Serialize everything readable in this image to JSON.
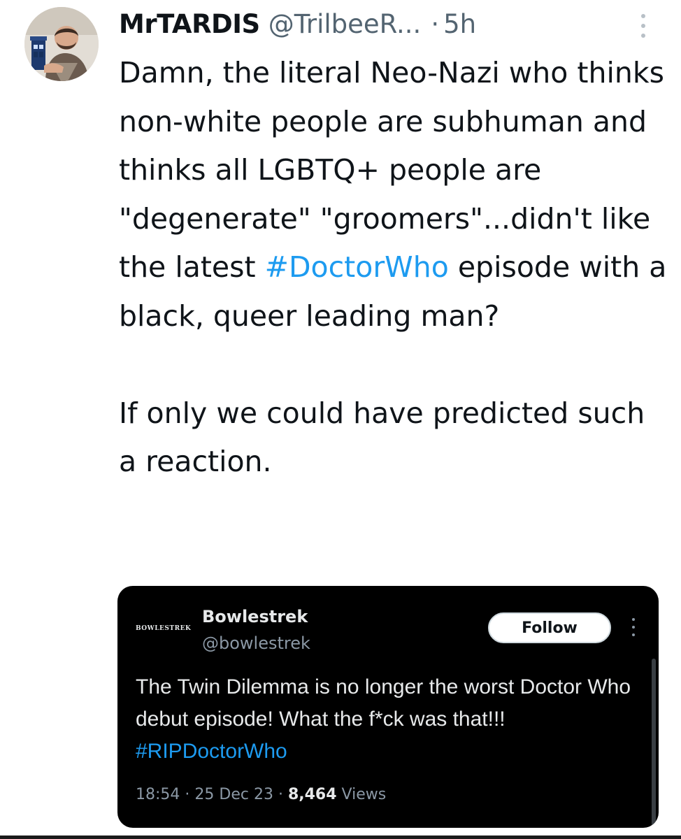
{
  "tweet": {
    "display_name": "MrTARDIS",
    "handle": "@TrilbeeR...",
    "separator": "·",
    "time": "5h",
    "text_before_hashtag": "Damn, the literal Neo-Nazi who thinks non-white people are subhuman and thinks all LGBTQ+ people are \"degenerate\" \"groomers\"...didn't like the latest ",
    "hashtag": "#DoctorWho",
    "text_after_hashtag": " episode with a black, queer leading man?\n\nIf only we could have predicted such a reaction."
  },
  "quoted_tweet": {
    "logo_text": "BOWLESTREK",
    "display_name": "Bowlestrek",
    "handle": "@bowlestrek",
    "follow_label": "Follow",
    "text": "The Twin Dilemma is no longer the worst Doctor Who debut episode! What the f*ck was that!!! ",
    "hashtag": "#RIPDoctorWho",
    "time": "18:54",
    "date": "25 Dec 23",
    "separator": "·",
    "views_count": "8,464",
    "views_label": "Views"
  },
  "colors": {
    "hashtag": "#1d9bf0",
    "secondary_text": "#536471",
    "quote_background": "#000000"
  }
}
